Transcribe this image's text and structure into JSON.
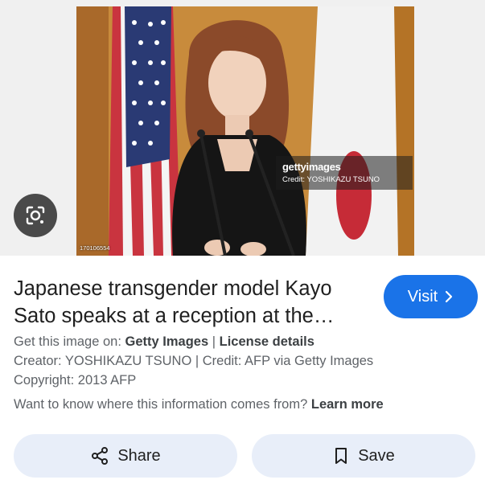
{
  "image": {
    "watermark_brand": "gettyimages",
    "credit": "Credit: YOSHIKAZU TSUNO",
    "image_id": "170106554",
    "lens_icon": "google-lens-icon"
  },
  "result": {
    "title": "Japanese transgender model Kayo Sato speaks at a reception at the…",
    "visit_label": "Visit",
    "visit_icon": "chevron-right-icon",
    "get_image_prefix": "Get this image on:",
    "source_name": "Getty Images",
    "separator": "|",
    "license_label": "License details",
    "creator_line": "Creator: YOSHIKAZU TSUNO | Credit: AFP via Getty Images",
    "copyright_line": "Copyright: 2013 AFP",
    "info_question": "Want to know where this information comes from?",
    "learn_more": "Learn more"
  },
  "actions": {
    "share_label": "Share",
    "share_icon": "share-icon",
    "save_label": "Save",
    "save_icon": "bookmark-icon"
  },
  "colors": {
    "accent": "#1a73e8",
    "button_bg": "#e8eef9",
    "lens_bg": "#4a4a4a"
  }
}
